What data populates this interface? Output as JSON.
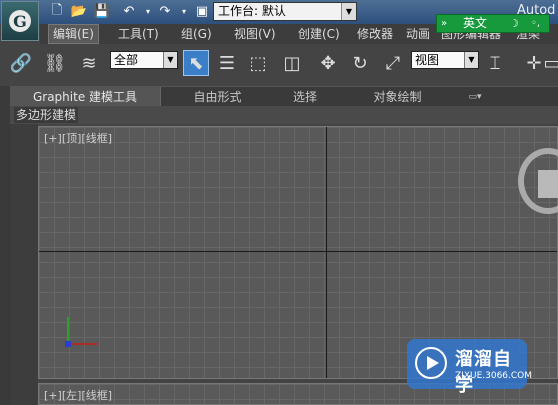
{
  "titlebar": {
    "workspace_label": "工作台: 默认",
    "app_title": "Autod"
  },
  "ime": {
    "label": "英文"
  },
  "menu": {
    "items": [
      "编辑(E)",
      "工具(T)",
      "组(G)",
      "视图(V)",
      "创建(C)",
      "修改器",
      "动画",
      "图形编辑器",
      "渲染(R)"
    ]
  },
  "toolbar": {
    "selection_filter": "全部",
    "coord_system": "视图"
  },
  "ribbon": {
    "tabs": [
      "Graphite 建模工具",
      "自由形式",
      "选择",
      "对象绘制"
    ],
    "panel_label": "多边形建模"
  },
  "viewports": {
    "top": {
      "plus": "[+]",
      "view": "[顶]",
      "shading": "[线框]"
    },
    "left": {
      "plus": "[+]",
      "view": "[左]",
      "shading": "[线框]"
    }
  },
  "watermark": {
    "title": "溜溜自学",
    "url": "ZIXUE.3066.COM"
  }
}
